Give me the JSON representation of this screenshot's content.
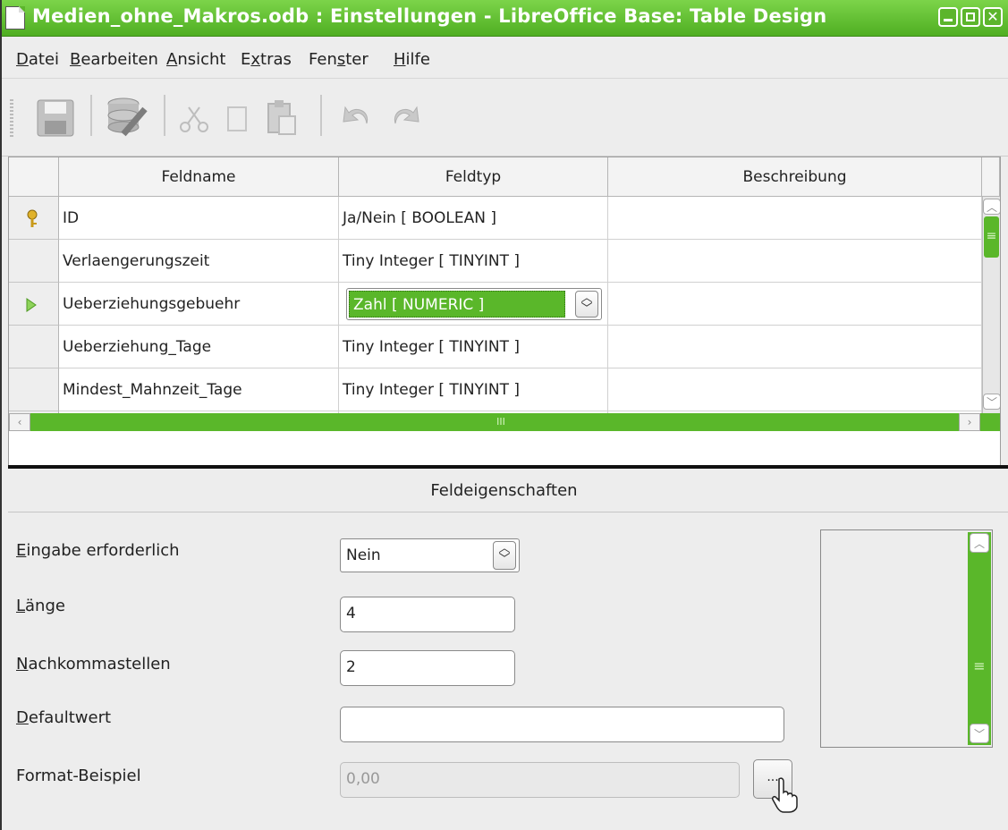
{
  "window": {
    "title": "Medien_ohne_Makros.odb : Einstellungen - LibreOffice Base: Table Design",
    "accent_color": "#5cb52c"
  },
  "menu": [
    {
      "pre": "",
      "u": "D",
      "post": "atei"
    },
    {
      "pre": "",
      "u": "B",
      "post": "earbeiten"
    },
    {
      "pre": "",
      "u": "A",
      "post": "nsicht"
    },
    {
      "pre": "E",
      "u": "x",
      "post": "tras"
    },
    {
      "pre": "Fen",
      "u": "s",
      "post": "ter"
    },
    {
      "pre": "",
      "u": "H",
      "post": "ilfe"
    }
  ],
  "toolbar": {
    "icons": [
      "save-icon",
      "database-icon",
      "cut-icon",
      "copy-icon",
      "paste-icon",
      "undo-icon",
      "redo-icon"
    ]
  },
  "grid": {
    "headers": {
      "name": "Feldname",
      "type": "Feldtyp",
      "desc": "Beschreibung"
    },
    "rows": [
      {
        "name": "ID",
        "type": "Ja/Nein [ BOOLEAN ]",
        "desc": "",
        "marker": "primary-key"
      },
      {
        "name": "Verlaengerungszeit",
        "type": "Tiny Integer [ TINYINT ]",
        "desc": "",
        "marker": ""
      },
      {
        "name": "Ueberziehungsgebuehr",
        "type": "Zahl [ NUMERIC ]",
        "desc": "",
        "marker": "current"
      },
      {
        "name": "Ueberziehung_Tage",
        "type": "Tiny Integer [ TINYINT ]",
        "desc": "",
        "marker": ""
      },
      {
        "name": "Mindest_Mahnzeit_Tage",
        "type": "Tiny Integer [ TINYINT ]",
        "desc": "",
        "marker": ""
      }
    ],
    "hscroll_thumb": "III",
    "vscroll_thumb": "≡"
  },
  "properties": {
    "title": "Feldeigenschaften",
    "required": {
      "label_u": "E",
      "label_rest": "ingabe erforderlich",
      "value": "Nein"
    },
    "length": {
      "label_u": "L",
      "label_rest": "änge",
      "value": "4"
    },
    "decimals": {
      "label_u": "N",
      "label_rest": "achkommastellen",
      "value": "2"
    },
    "default": {
      "label_u": "D",
      "label_rest": "efaultwert",
      "value": ""
    },
    "format": {
      "label": "Format-Beispiel",
      "value": "0,00",
      "button": "..."
    },
    "help_scroll_thumb": "≡"
  }
}
